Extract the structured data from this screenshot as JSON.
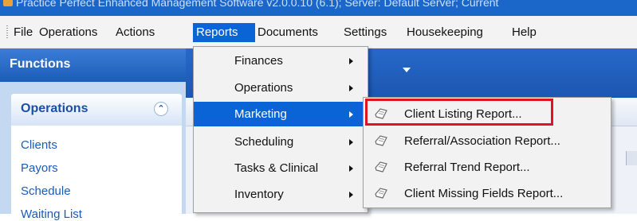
{
  "window": {
    "title": "Practice Perfect Enhanced Management Software v2.0.0.10 (6.1); Server: Default Server; Current"
  },
  "menubar": {
    "items": [
      {
        "label": "File"
      },
      {
        "label": "Operations"
      },
      {
        "label": "Actions"
      },
      {
        "label": "Reports"
      },
      {
        "label": "Documents"
      },
      {
        "label": "Settings"
      },
      {
        "label": "Housekeeping"
      },
      {
        "label": "Help"
      }
    ],
    "active": "Reports"
  },
  "functions_panel": {
    "header": "Functions",
    "section": {
      "title": "Operations",
      "links": [
        "Clients",
        "Payors",
        "Schedule",
        "Waiting List"
      ]
    }
  },
  "reports_menu": {
    "items": [
      {
        "label": "Finances",
        "has_submenu": true
      },
      {
        "label": "Operations",
        "has_submenu": true
      },
      {
        "label": "Marketing",
        "has_submenu": true,
        "active": true
      },
      {
        "label": "Scheduling",
        "has_submenu": true
      },
      {
        "label": "Tasks & Clinical",
        "has_submenu": true
      },
      {
        "label": "Inventory",
        "has_submenu": true
      }
    ]
  },
  "marketing_submenu": {
    "items": [
      {
        "label": "Client Listing Report...",
        "icon": "report-document-icon",
        "highlighted": true
      },
      {
        "label": "Referral/Association Report...",
        "icon": "report-document-icon"
      },
      {
        "label": "Referral Trend Report...",
        "icon": "report-document-icon"
      },
      {
        "label": "Client Missing Fields Report...",
        "icon": "report-document-icon"
      }
    ]
  },
  "colors": {
    "menu_highlight": "#0a64d6",
    "panel_header": "#2a6cc8",
    "annotation_red": "#e0141e",
    "link_blue": "#1b5bb8"
  }
}
